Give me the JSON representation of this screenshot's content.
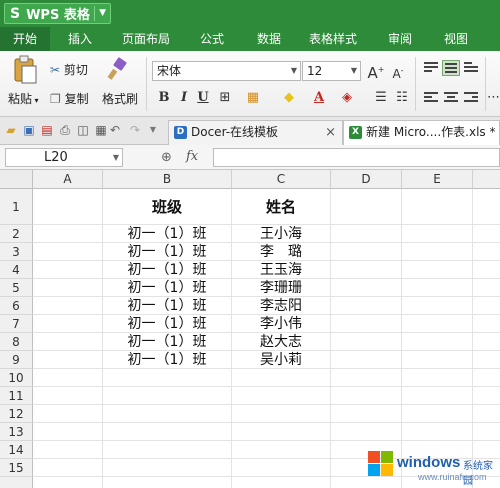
{
  "app": {
    "logo": "S",
    "title": "WPS 表格"
  },
  "menu": {
    "tabs": [
      "开始",
      "插入",
      "页面布局",
      "公式",
      "数据",
      "表格样式",
      "审阅",
      "视图"
    ]
  },
  "ribbon": {
    "paste_label": "粘贴",
    "cut_label": "剪切",
    "copy_label": "复制",
    "format_painter_label": "格式刷",
    "font_name": "宋体",
    "font_size": "12",
    "bold": "B",
    "italic": "I",
    "underline": "U",
    "grow": "A",
    "shrink": "A"
  },
  "tabs": [
    {
      "label": "Docer-在线模板",
      "icon": "docer-icon"
    },
    {
      "label": "新建 Micro....作表.xls *",
      "icon": "xls-icon"
    }
  ],
  "formula_bar": {
    "cell_ref": "L20",
    "fx": "fx",
    "content": ""
  },
  "grid": {
    "columns": [
      "A",
      "B",
      "C",
      "D",
      "E"
    ],
    "rows": [
      "1",
      "2",
      "3",
      "4",
      "5",
      "6",
      "7",
      "8",
      "9",
      "10",
      "11",
      "12",
      "13",
      "14",
      "15"
    ],
    "header": {
      "class": "班级",
      "name": "姓名"
    },
    "data": [
      {
        "class": "初一（1）班",
        "name": "王小海"
      },
      {
        "class": "初一（1）班",
        "name": "李　璐"
      },
      {
        "class": "初一（1）班",
        "name": "王玉海"
      },
      {
        "class": "初一（1）班",
        "name": "李珊珊"
      },
      {
        "class": "初一（1）班",
        "name": "李志阳"
      },
      {
        "class": "初一（1）班",
        "name": "李小伟"
      },
      {
        "class": "初一（1）班",
        "name": "赵大志"
      },
      {
        "class": "初一（1）班",
        "name": "吴小莉"
      }
    ]
  },
  "watermark": {
    "brand": "windows",
    "suffix": "系统家园",
    "url": "www.ruinafu.com"
  }
}
